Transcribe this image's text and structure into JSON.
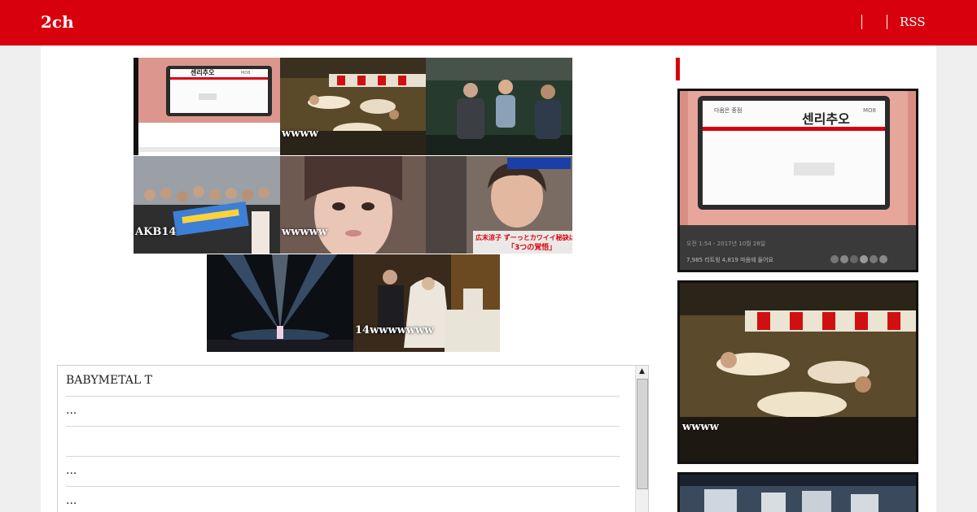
{
  "site": {
    "title": "2ch",
    "rss_label": "RSS"
  },
  "gallery": [
    {
      "caption": "",
      "scene": "subway-sign"
    },
    {
      "caption": "wwww",
      "scene": "dancers"
    },
    {
      "caption": "",
      "scene": "talkshow"
    },
    {
      "caption": "AKB14",
      "scene": "group-photo"
    },
    {
      "caption": "wwwww",
      "scene": "face"
    },
    {
      "caption": "",
      "scene": "tv-variety"
    },
    {
      "caption": "",
      "scene": "concert-stage"
    },
    {
      "caption": "14wwwwwww",
      "scene": "church"
    }
  ],
  "subway_sign": {
    "korean_main": "센리추오",
    "korean_small": "다음은 종점",
    "code": "MO8",
    "footer_left": "오전 1:54 - 2017년 10월 28일",
    "counts": "7,985 리트윗  4,819 마음에 들어요"
  },
  "tv_caption": {
    "line1": "広末涼子 ずーっとカワイイ秘訣は",
    "line2": "「3つの覚悟」"
  },
  "article_list": [
    "BABYMETAL T",
    "...",
    "",
    " ...",
    "..."
  ],
  "sidebar": {
    "cards": [
      {
        "caption": "",
        "scene": "subway-sign"
      },
      {
        "caption": "wwww",
        "scene": "dancers"
      },
      {
        "caption": "",
        "scene": "stairs"
      }
    ]
  },
  "colors": {
    "brand_red": "#d8000c",
    "content_bg": "#ffffff",
    "page_bg": "#efefef"
  }
}
